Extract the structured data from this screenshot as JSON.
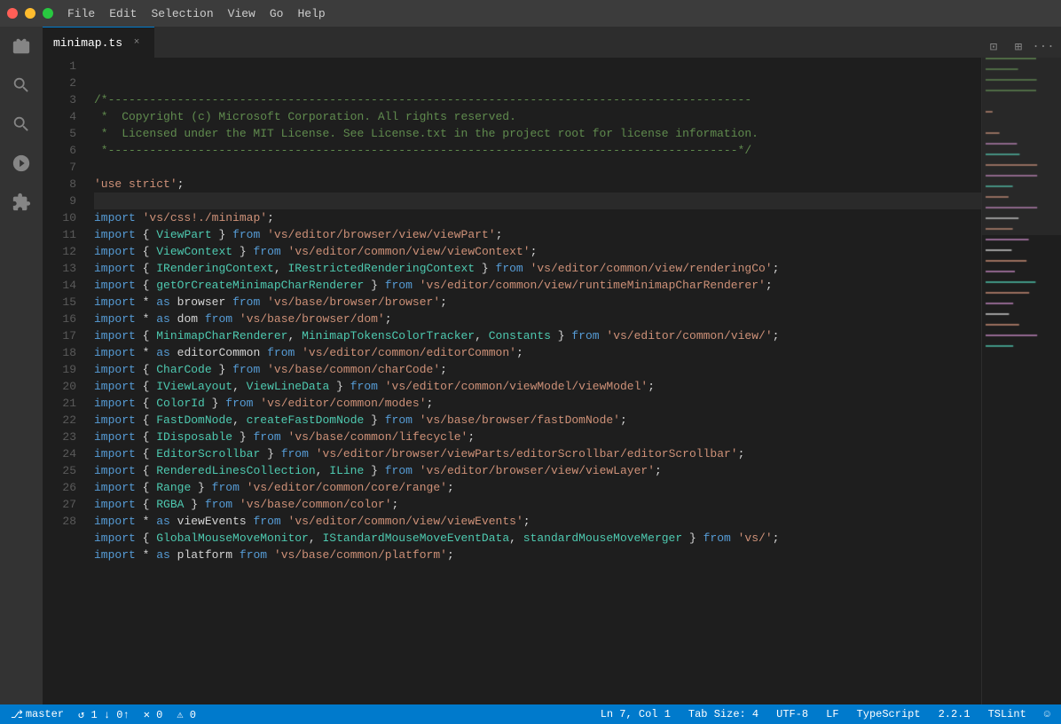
{
  "titlebar": {
    "menus": [
      "File",
      "Edit",
      "Selection",
      "View",
      "Go",
      "Help"
    ]
  },
  "tab": {
    "filename": "minimap.ts",
    "close_label": "×"
  },
  "tab_actions": {
    "split_label": "⊡",
    "layout_label": "⊞",
    "more_label": "···"
  },
  "activity_bar": {
    "icons": [
      "explorer",
      "search",
      "source-control",
      "debug",
      "extensions"
    ]
  },
  "status_bar": {
    "branch": "master",
    "sync": "↺ 1 ↓ 0↑",
    "errors": "✕ 0",
    "warnings": "⚠ 0",
    "position": "Ln 7, Col 1",
    "tab_size": "Tab Size: 4",
    "encoding": "UTF-8",
    "line_ending": "LF",
    "language": "TypeScript",
    "version": "2.2.1",
    "linter": "TSLint",
    "smiley": "☺"
  },
  "code": {
    "lines": [
      {
        "num": 1,
        "type": "comment",
        "text": "/*---------------------------------------------------------------------------------------------"
      },
      {
        "num": 2,
        "type": "comment",
        "text": " *  Copyright (c) Microsoft Corporation. All rights reserved."
      },
      {
        "num": 3,
        "type": "comment",
        "text": " *  Licensed under the MIT License. See License.txt in the project root for license information."
      },
      {
        "num": 4,
        "type": "comment",
        "text": " *-------------------------------------------------------------------------------------------*/"
      },
      {
        "num": 5,
        "type": "blank",
        "text": ""
      },
      {
        "num": 6,
        "type": "code",
        "text": "'use strict';"
      },
      {
        "num": 7,
        "type": "highlighted",
        "text": ""
      },
      {
        "num": 8,
        "type": "code",
        "text": "import 'vs/css!./minimap';"
      },
      {
        "num": 9,
        "type": "code",
        "text": "import { ViewPart } from 'vs/editor/browser/view/viewPart';"
      },
      {
        "num": 10,
        "type": "code",
        "text": "import { ViewContext } from 'vs/editor/common/view/viewContext';"
      },
      {
        "num": 11,
        "type": "code",
        "text": "import { IRenderingContext, IRestrictedRenderingContext } from 'vs/editor/common/view/renderingCo"
      },
      {
        "num": 12,
        "type": "code",
        "text": "import { getOrCreateMinimapCharRenderer } from 'vs/editor/common/view/runtimeMinimapCharRenderer'"
      },
      {
        "num": 13,
        "type": "code",
        "text": "import * as browser from 'vs/base/browser/browser';"
      },
      {
        "num": 14,
        "type": "code",
        "text": "import * as dom from 'vs/base/browser/dom';"
      },
      {
        "num": 15,
        "type": "code",
        "text": "import { MinimapCharRenderer, MinimapTokensColorTracker, Constants } from 'vs/editor/common/view/"
      },
      {
        "num": 16,
        "type": "code",
        "text": "import * as editorCommon from 'vs/editor/common/editorCommon';"
      },
      {
        "num": 17,
        "type": "code",
        "text": "import { CharCode } from 'vs/base/common/charCode';"
      },
      {
        "num": 18,
        "type": "code",
        "text": "import { IViewLayout, ViewLineData } from 'vs/editor/common/viewModel/viewModel';"
      },
      {
        "num": 19,
        "type": "code",
        "text": "import { ColorId } from 'vs/editor/common/modes';"
      },
      {
        "num": 20,
        "type": "code",
        "text": "import { FastDomNode, createFastDomNode } from 'vs/base/browser/fastDomNode';"
      },
      {
        "num": 21,
        "type": "code",
        "text": "import { IDisposable } from 'vs/base/common/lifecycle';"
      },
      {
        "num": 22,
        "type": "code",
        "text": "import { EditorScrollbar } from 'vs/editor/browser/viewParts/editorScrollbar/editorScrollbar';"
      },
      {
        "num": 23,
        "type": "code",
        "text": "import { RenderedLinesCollection, ILine } from 'vs/editor/browser/view/viewLayer';"
      },
      {
        "num": 24,
        "type": "code",
        "text": "import { Range } from 'vs/editor/common/core/range';"
      },
      {
        "num": 25,
        "type": "code",
        "text": "import { RGBA } from 'vs/base/common/color';"
      },
      {
        "num": 26,
        "type": "code",
        "text": "import * as viewEvents from 'vs/editor/common/view/viewEvents';"
      },
      {
        "num": 27,
        "type": "code",
        "text": "import { GlobalMouseMoveMonitor, IStandardMouseMoveEventData, standardMouseMoveMerger } from 'vs/"
      },
      {
        "num": 28,
        "type": "code",
        "text": "import * as platform from 'vs/base/common/platform';"
      }
    ]
  }
}
